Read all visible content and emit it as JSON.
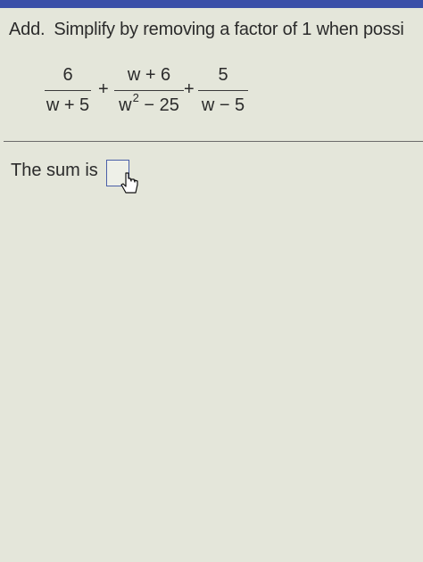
{
  "instruction": {
    "verb": "Add.",
    "text": "Simplify by removing a factor of 1 when possi"
  },
  "expression": {
    "term1": {
      "numerator": "6",
      "denominator": "w + 5"
    },
    "op1": "+",
    "term2": {
      "numerator": "w + 6",
      "denominator_base": "w",
      "denominator_exp": "2",
      "denominator_rest": " − 25"
    },
    "op2": "+",
    "term3": {
      "numerator": "5",
      "denominator": "w − 5"
    }
  },
  "answer": {
    "label": "The sum is",
    "value": ""
  },
  "colors": {
    "background": "#e4e6da",
    "accent": "#3a4fa8"
  },
  "icons": {
    "cursor": "hand-pointer-icon"
  }
}
